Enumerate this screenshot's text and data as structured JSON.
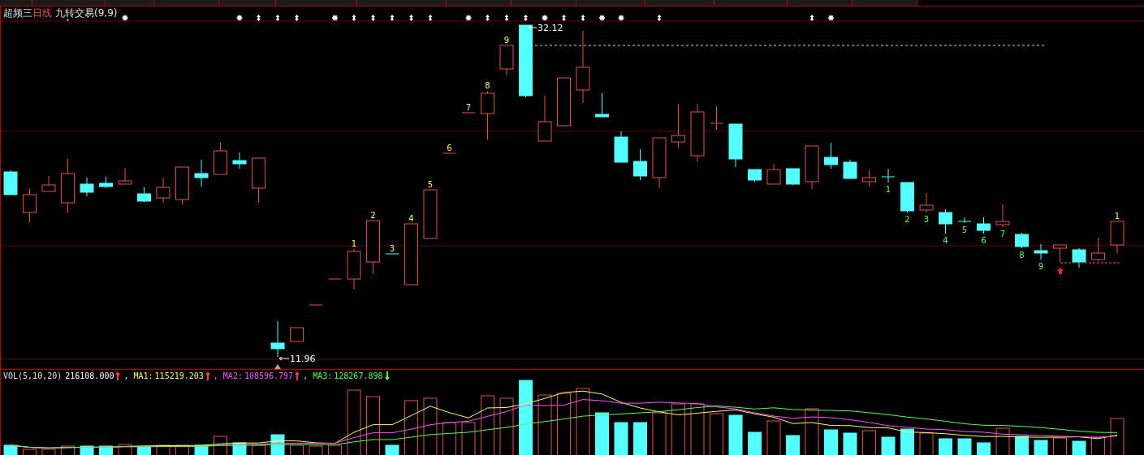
{
  "title": {
    "stock": "超频三",
    "period": "日线",
    "indicator": "九转交易(9,9)"
  },
  "price_annotations": [
    {
      "kind": "high",
      "text": "32.12"
    },
    {
      "kind": "low",
      "text": "11.96"
    }
  ],
  "setup_counts": [
    {
      "text": "1",
      "kind": "up"
    },
    {
      "text": "2",
      "kind": "up"
    },
    {
      "text": "3",
      "kind": "up"
    },
    {
      "text": "4",
      "kind": "up"
    },
    {
      "text": "5",
      "kind": "up"
    },
    {
      "text": "6",
      "kind": "up"
    },
    {
      "text": "7",
      "kind": "up"
    },
    {
      "text": "8",
      "kind": "up"
    },
    {
      "text": "9",
      "kind": "up"
    },
    {
      "text": "1",
      "kind": "down"
    },
    {
      "text": "2",
      "kind": "down"
    },
    {
      "text": "3",
      "kind": "down"
    },
    {
      "text": "4",
      "kind": "down"
    },
    {
      "text": "5",
      "kind": "down"
    },
    {
      "text": "6",
      "kind": "down"
    },
    {
      "text": "7",
      "kind": "down"
    },
    {
      "text": "8",
      "kind": "down"
    },
    {
      "text": "9",
      "kind": "down"
    },
    {
      "text": "1",
      "kind": "up"
    }
  ],
  "volume_header": {
    "title": "VOL(5,10,20)",
    "items": [
      {
        "value": "216108.000",
        "rising": true,
        "color": "#ffffff"
      },
      {
        "label": ", MA1:",
        "value": "115219.203",
        "rising": true,
        "color": "#ffff54"
      },
      {
        "label": ", MA2:",
        "value": "108596.797",
        "rising": true,
        "color": "#ff54ff"
      },
      {
        "label": ", MA3:",
        "value": "128267.898",
        "rising": false,
        "color": "#54ff54"
      }
    ]
  }
}
